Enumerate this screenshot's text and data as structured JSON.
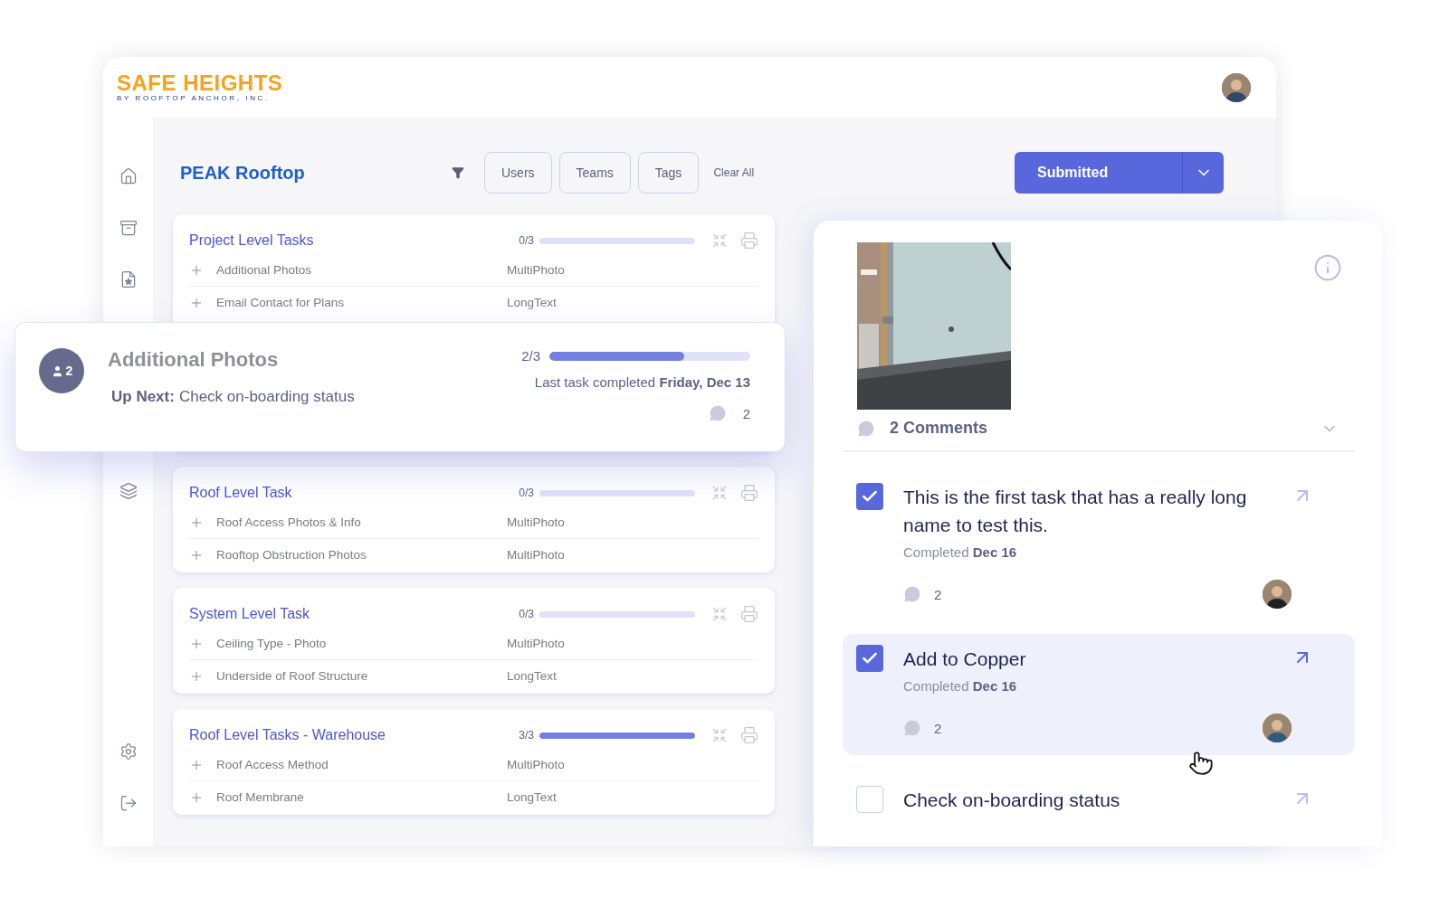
{
  "logo": {
    "name": "SAFE HEIGHTS",
    "tagline": "BY ROOFTOP ANCHOR, INC."
  },
  "project": {
    "title": "PEAK Rooftop"
  },
  "filters": [
    {
      "label": "Users"
    },
    {
      "label": "Teams"
    },
    {
      "label": "Tags"
    }
  ],
  "clear_all": "Clear All",
  "status_button": {
    "label": "Submitted"
  },
  "task_groups": [
    {
      "title": "Project Level Tasks",
      "progress": "0/3",
      "level": 0,
      "rows": [
        {
          "name": "Additional Photos",
          "type": "MultiPhoto"
        },
        {
          "name": "Email Contact for Plans",
          "type": "LongText"
        }
      ]
    },
    {
      "title": "Roof Level Task",
      "progress": "0/3",
      "level": 0,
      "rows": [
        {
          "name": "Roof Access Photos & Info",
          "type": "MultiPhoto"
        },
        {
          "name": "Rooftop Obstruction Photos",
          "type": "MultiPhoto"
        }
      ]
    },
    {
      "title": "System Level Task",
      "progress": "0/3",
      "level": 0,
      "rows": [
        {
          "name": "Ceiling Type - Photo",
          "type": "MultiPhoto"
        },
        {
          "name": "Underside of Roof Structure",
          "type": "LongText"
        }
      ]
    },
    {
      "title": "Roof Level Tasks - Warehouse",
      "progress": "3/3",
      "level": 1,
      "rows": [
        {
          "name": "Roof Access Method",
          "type": "MultiPhoto"
        },
        {
          "name": "Roof Membrane",
          "type": "LongText"
        }
      ]
    }
  ],
  "summary_card": {
    "title": "Additional Photos",
    "badge": "2",
    "up_next_label": "Up Next:",
    "up_next": "Check on-boarding status",
    "progress": "2/3",
    "level": 0.67,
    "last_completed": "Last task completed **Friday, Dec 13**",
    "comments": "2"
  },
  "detail": {
    "comments_label": "2 Comments",
    "tasks": [
      {
        "title": "This is the first task that has a really long name to test this.",
        "checked": true,
        "selected": false,
        "completed": "Completed **Dec 16**",
        "comments": "2"
      },
      {
        "title": "Add to Copper",
        "checked": true,
        "selected": true,
        "completed": "Completed **Dec 16**",
        "comments": "2"
      },
      {
        "title": "Check on-boarding status",
        "checked": false,
        "selected": false
      }
    ]
  }
}
